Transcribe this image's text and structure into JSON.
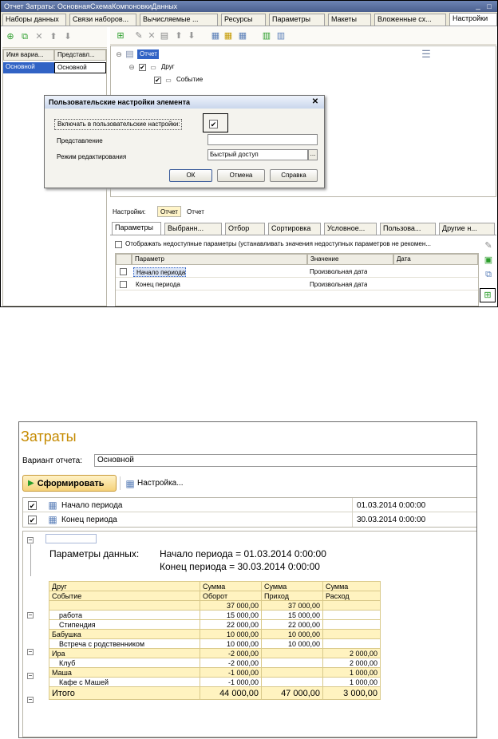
{
  "window1": {
    "title": "Отчет Затраты: ОсновнаяСхемаКомпоновкиДанных",
    "tabs": [
      "Наборы данных",
      "Связи наборов...",
      "Вычисляемые ...",
      "Ресурсы",
      "Параметры",
      "Макеты",
      "Вложенные сх...",
      "Настройки"
    ],
    "variants_grid": {
      "headers": [
        "Имя вариа...",
        "Представл..."
      ],
      "row": [
        "Основной",
        "Основной"
      ]
    },
    "tree": {
      "root": "Отчет",
      "child": "Друг",
      "grandchild": "Событие"
    },
    "dialog": {
      "title": "Пользовательские настройки элемента",
      "include_label": "Включать в пользовательские настройки:",
      "include_checked": "✔",
      "presentation_label": "Представление",
      "presentation_value": "",
      "edit_mode_label": "Режим редактирования",
      "edit_mode_value": "Быстрый доступ",
      "ok": "ОК",
      "cancel": "Отмена",
      "help": "Справка"
    },
    "settings_label": "Настройки:",
    "settings_report": "Отчет",
    "settings_report2": "Отчет",
    "settings_tabs": [
      "Параметры",
      "Выбранн...",
      "Отбор",
      "Сортировка",
      "Условное...",
      "Пользова...",
      "Другие н..."
    ],
    "show_unavailable": "Отображать недоступные параметры (устанавливать значения недоступных параметров не рекомен...",
    "params_headers": [
      "Параметр",
      "Значение",
      "Дата"
    ],
    "params_rows": [
      {
        "name": "Начало периода",
        "value": "Произвольная дата"
      },
      {
        "name": "Конец периода",
        "value": "Произвольная дата"
      }
    ]
  },
  "window2": {
    "title": "Затраты",
    "variant_label": "Вариант отчета:",
    "variant_value": "Основной",
    "generate": "Сформировать",
    "settings": "Настройка...",
    "params": [
      {
        "name": "Начало периода",
        "value": "01.03.2014 0:00:00"
      },
      {
        "name": "Конец периода",
        "value": "30.03.2014 0:00:00"
      }
    ],
    "data_params_label": "Параметры данных:",
    "data_params_1": "Начало периода = 01.03.2014 0:00:00",
    "data_params_2": "Конец периода = 30.03.2014 0:00:00",
    "table": {
      "h1": [
        "Друг",
        "Сумма",
        "Сумма",
        "Сумма"
      ],
      "h2": [
        "Событие",
        "Оборот",
        "Приход",
        "Расход"
      ],
      "rows": [
        {
          "name": "",
          "turnover": "37 000,00",
          "income": "37 000,00",
          "expense": ""
        },
        {
          "name": "работа",
          "turnover": "15 000,00",
          "income": "15 000,00",
          "expense": ""
        },
        {
          "name": "Стипендия",
          "turnover": "22 000,00",
          "income": "22 000,00",
          "expense": ""
        },
        {
          "name": "Бабушка",
          "turnover": "10 000,00",
          "income": "10 000,00",
          "expense": ""
        },
        {
          "name": "Встреча с родственником",
          "turnover": "10 000,00",
          "income": "10 000,00",
          "expense": ""
        },
        {
          "name": "Ира",
          "turnover": "-2 000,00",
          "income": "",
          "expense": "2 000,00"
        },
        {
          "name": "Клуб",
          "turnover": "-2 000,00",
          "income": "",
          "expense": "2 000,00"
        },
        {
          "name": "Маша",
          "turnover": "-1 000,00",
          "income": "",
          "expense": "1 000,00"
        },
        {
          "name": "Кафе  с Машей",
          "turnover": "-1 000,00",
          "income": "",
          "expense": "1 000,00"
        }
      ],
      "total": {
        "name": "Итого",
        "turnover": "44 000,00",
        "income": "47 000,00",
        "expense": "3 000,00"
      }
    }
  },
  "colors": {
    "accent": "#c58a00",
    "tab_active": "#ffffff",
    "selection": "#3163c5"
  }
}
